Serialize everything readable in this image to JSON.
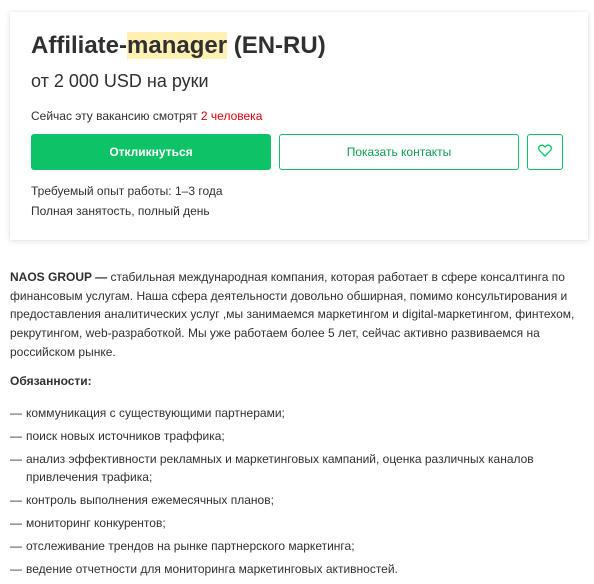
{
  "vacancy": {
    "title_prefix": "Affiliate-",
    "title_highlight": "manager",
    "title_suffix": " (EN-RU)",
    "salary": "от 2 000 USD на руки",
    "viewers_text": "Сейчас эту вакансию смотрят ",
    "viewers_count": "2 человека",
    "apply_label": "Откликнуться",
    "contacts_label": "Показать контакты",
    "favorite_icon": "heart-icon",
    "experience": "Требуемый опыт работы: 1–3 года",
    "employment": "Полная занятость, полный день"
  },
  "description": {
    "company": "NAOS GROUP —",
    "text": " стабильная международная компания, которая работает в сфере консалтинга по финансовым услугам. Наша сфера деятельности довольно обширная, помимо консультирования и предоставления аналитических услуг ,мы занимаемся маркетингом и digital-маркетингом, финтехом, рекрутингом, web-разработкой. Мы уже работаем более 5 лет, сейчас активно развиваемся на российском рынке."
  },
  "responsibilities": {
    "heading": "Обязанности:",
    "dash": "—",
    "items": [
      "коммуникация с существующими партнерами;",
      "поиск новых источников траффика;",
      "анализ эффективности рекламных и маркетинговых кампаний, оценка различных каналов привлечения трафика;",
      "контроль выполнения ежемесячных планов;",
      "мониторинг конкурентов;",
      "отслеживание трендов на рынке партнерского маркетинга;",
      "ведение отчетности для мониторинга маркетинговых активностей."
    ]
  },
  "colors": {
    "accent_green": "#0dc267",
    "highlight": "#fff0b4",
    "count_red": "#e3000b"
  }
}
